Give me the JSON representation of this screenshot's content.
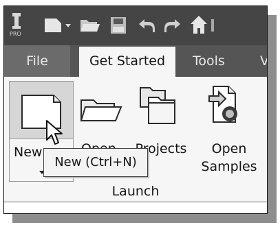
{
  "quick_access": {
    "icons": [
      "pro-logo-icon",
      "new-document-icon",
      "dropdown-arrow-icon",
      "open-folder-icon",
      "save-icon",
      "undo-icon",
      "redo-icon",
      "home-icon"
    ],
    "logo_text": "PRO"
  },
  "tabs": [
    {
      "label": "File"
    },
    {
      "label": "Get Started"
    },
    {
      "label": "Tools"
    },
    {
      "label": "V"
    }
  ],
  "panel": {
    "group_label": "Launch",
    "buttons": [
      {
        "label": "New",
        "icon": "new-document-icon"
      },
      {
        "label": "Open",
        "icon": "open-folder-icon"
      },
      {
        "label": "Projects",
        "icon": "projects-icon"
      },
      {
        "label": "Open",
        "label2": "Samples",
        "icon": "open-samples-icon"
      }
    ],
    "dropdown_icon": "dropdown-arrow-icon"
  },
  "tooltip": {
    "text": "New (Ctrl+N)"
  },
  "colors": {
    "toolbar": "#454545",
    "tab_bar": "#555555",
    "file_tab": "#6b6b6b",
    "panel": "#f6f6f6"
  }
}
